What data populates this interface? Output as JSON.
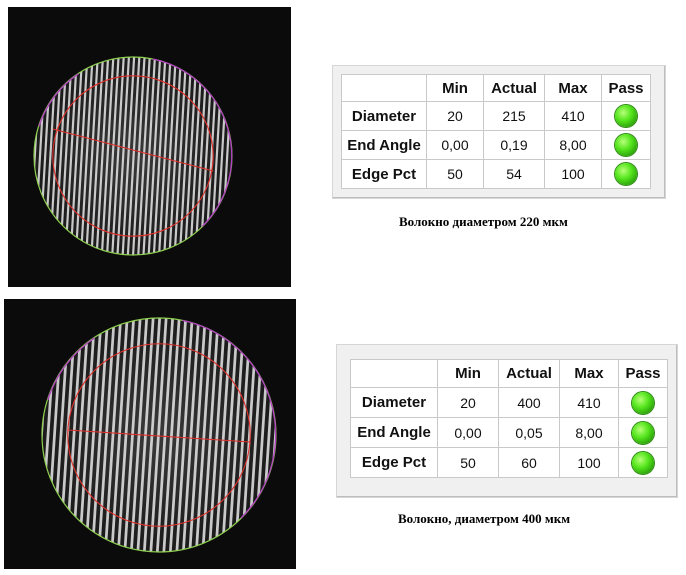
{
  "tables": [
    {
      "columns": [
        "",
        "Min",
        "Actual",
        "Max",
        "Pass"
      ],
      "rows": [
        {
          "label": "Diameter",
          "min": "20",
          "actual": "215",
          "max": "410",
          "pass": "green"
        },
        {
          "label": "End Angle",
          "min": "0,00",
          "actual": "0,19",
          "max": "8,00",
          "pass": "green"
        },
        {
          "label": "Edge Pct",
          "min": "50",
          "actual": "54",
          "max": "100",
          "pass": "green"
        }
      ],
      "caption": "Волокно диаметром 220 мкм"
    },
    {
      "columns": [
        "",
        "Min",
        "Actual",
        "Max",
        "Pass"
      ],
      "rows": [
        {
          "label": "Diameter",
          "min": "20",
          "actual": "400",
          "max": "410",
          "pass": "green"
        },
        {
          "label": "End Angle",
          "min": "0,00",
          "actual": "0,05",
          "max": "8,00",
          "pass": "green"
        },
        {
          "label": "Edge Pct",
          "min": "50",
          "actual": "60",
          "max": "100",
          "pass": "green"
        }
      ],
      "caption": "Волокно, диаметром 400 мкм"
    }
  ],
  "colors": {
    "fit_circle": "#8fd14f",
    "edge_arc": "#b040c0",
    "inner_circle": "#e0302a",
    "diameter_line": "#e0302a",
    "pass_lamp": "#3fcf14"
  }
}
